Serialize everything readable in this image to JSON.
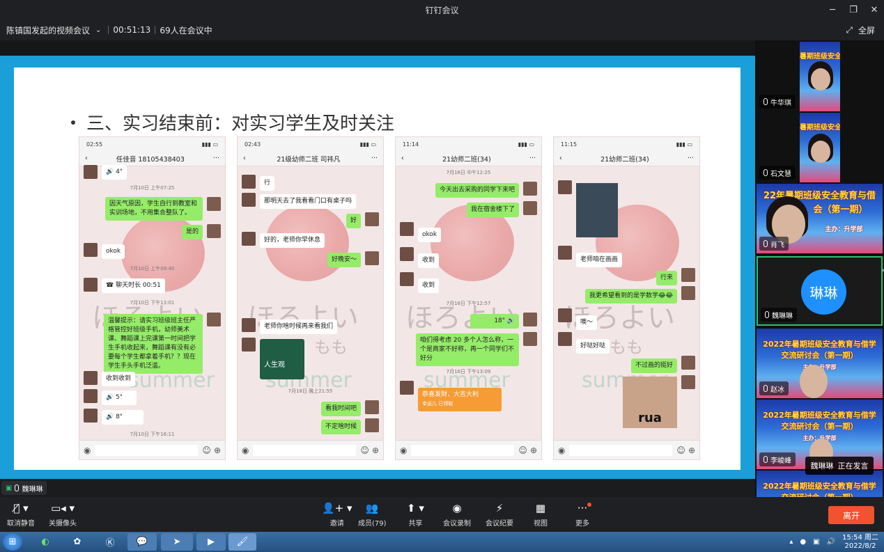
{
  "window": {
    "title": "钉钉会议"
  },
  "info": {
    "meeting_name": "陈镇国发起的视频会议",
    "duration": "00:51:13",
    "participants": "69人在会议中",
    "fullscreen": "全屏"
  },
  "slide": {
    "title": "三、实习结束前：对实习学生及时关注",
    "phones": [
      {
        "time": "02:55",
        "chat_title": "任佳音 18105438403",
        "messages": [
          {
            "side": "l",
            "text": "🔊 4\""
          },
          {
            "ts": "7月10日 上午07:25"
          },
          {
            "side": "r",
            "text": "因天气原因，学生自行到教室和实训场地，不用集合整队了。"
          },
          {
            "side": "r",
            "text": "是的"
          },
          {
            "side": "l",
            "text": "okok"
          },
          {
            "ts": "7月10日 上午09:40"
          },
          {
            "side": "l",
            "text": "☎ 聊天时长 00:51"
          },
          {
            "ts": "7月10日 下午13:01"
          },
          {
            "side": "r",
            "text": "温馨提示：请实习班级班主任严格管控好班级手机，幼师美术课、舞蹈课上完课第一时间把学生手机收起来，舞蹈课有没有必要每个学生都拿着手机？？现在学生手头手机泛滥。"
          },
          {
            "side": "l",
            "text": "收到收到"
          },
          {
            "side": "l",
            "text": "🔊 5\""
          },
          {
            "side": "l",
            "text": "🔊 8\""
          },
          {
            "ts": "7月10日 下午16:11"
          }
        ]
      },
      {
        "time": "02:43",
        "chat_title": "21级幼师二班 司祎凡",
        "messages": [
          {
            "side": "l",
            "text": "行"
          },
          {
            "side": "l",
            "text": "那明天去了我看看门口有桌子吗"
          },
          {
            "side": "r",
            "text": "好"
          },
          {
            "side": "l",
            "text": "好的，老师你早休息"
          },
          {
            "side": "r",
            "text": "好晚安～"
          },
          {
            "side": "l",
            "text": "老师你啥时候再来看我们"
          },
          {
            "side": "l",
            "text": "人生观"
          },
          {
            "ts": "7月18日 晚上21:55"
          },
          {
            "side": "r",
            "text": "看我时间吧"
          },
          {
            "side": "r",
            "text": "不定啥时候"
          }
        ]
      },
      {
        "time": "11:14",
        "chat_title": "21幼师二班(34)",
        "messages": [
          {
            "ts": "7月16日 中午12:25"
          },
          {
            "side": "r",
            "text": "今天出去采购的同学下来吧"
          },
          {
            "side": "r",
            "text": "我在宿舍楼下了"
          },
          {
            "side": "l",
            "text": "okok"
          },
          {
            "side": "l",
            "text": "收到"
          },
          {
            "side": "l",
            "text": "收到"
          },
          {
            "ts": "7月16日 下午12:57"
          },
          {
            "side": "r",
            "text": "18\" 🔊"
          },
          {
            "side": "r",
            "text": "咱们得考虑 20 多个人怎么称，一个是商家不好称，再一个同学们不好分"
          },
          {
            "ts": "7月16日 下午13:09"
          },
          {
            "side": "l",
            "text": "恭喜发财，大吉大利"
          },
          {
            "side": "l",
            "text": "幸运儿 已领取"
          }
        ]
      },
      {
        "time": "11:15",
        "chat_title": "21幼师二班(34)",
        "messages": [
          {
            "side": "l",
            "text": "老师咱在画画"
          },
          {
            "side": "r",
            "text": "行来"
          },
          {
            "side": "r",
            "text": "我更希望看到的是学数学😂😂"
          },
          {
            "side": "l",
            "text": "噢～"
          },
          {
            "side": "l",
            "text": "好哒好哒"
          },
          {
            "side": "r",
            "text": "不过画的挺好"
          },
          {
            "side": "r",
            "text": "rua"
          }
        ]
      }
    ],
    "deco_hiragana": "ほろよい",
    "deco_summer": "summer",
    "deco_momo": "もも"
  },
  "sidebar": {
    "tiles": [
      {
        "name": "牛华琪",
        "poster": "暑期班级安全教育研讨会（第一"
      },
      {
        "name": "石文慧",
        "poster": "暑期班级安全教育研讨会（第一"
      },
      {
        "name": "肖飞",
        "poster": "22年暑期班级安全教育与借",
        "poster2": "会（第一期）",
        "poster3": "主办：升学部"
      },
      {
        "name": "魏琳琳",
        "avatar": "琳琳"
      },
      {
        "name": "赵冰",
        "poster": "2022年暑期班级安全教育与借学",
        "poster2": "交流研讨会（第一期）",
        "poster3": "主办：升学部"
      },
      {
        "name": "李峻峰",
        "poster": "2022年暑期班级安全教育与借学",
        "poster2": "交流研讨会（第一期）",
        "poster3": "主办：升学部"
      },
      {
        "poster": "2022年暑期班级安全教育与借学",
        "poster2": "交流研讨会（第一期）"
      }
    ],
    "speaking": {
      "name": "魏琳琳",
      "status": "正在发言"
    }
  },
  "speaker_bar": {
    "name": "魏琳琳"
  },
  "toolbar": {
    "mute": "取消静音",
    "camera": "关摄像头",
    "invite": "邀请",
    "members": "成员(79)",
    "share": "共享",
    "record": "会议录制",
    "minutes": "会议纪要",
    "view": "视图",
    "more": "更多",
    "leave": "离开"
  },
  "taskbar": {
    "time": "15:54 周二",
    "date": "2022/8/2"
  },
  "colors": {
    "accent": "#1e90ff",
    "leave": "#f2522e",
    "chat_green": "#95ec69",
    "slide_border": "#1a9fd8"
  }
}
